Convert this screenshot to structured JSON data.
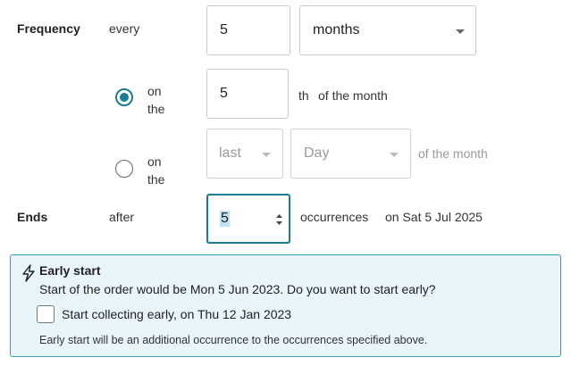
{
  "frequency": {
    "label": "Frequency",
    "every_label": "every",
    "interval_value": "5",
    "unit_selected": "months"
  },
  "on_the_day": {
    "selected": true,
    "label_line1": "on",
    "label_line2": "the",
    "day_value": "5",
    "suffix_th": "th",
    "suffix_text": "of the month"
  },
  "on_the_weekday": {
    "selected": false,
    "label_line1": "on",
    "label_line2": "the",
    "ordinal_selected": "last",
    "weekday_selected": "Day",
    "suffix_text": "of the month"
  },
  "ends": {
    "label": "Ends",
    "after_label": "after",
    "occurrences_value": "5",
    "occurrences_label": "occurrences",
    "end_date_text": "on Sat 5 Jul 2025"
  },
  "early_start": {
    "title": "Early start",
    "message": "Start of the order would be Mon 5 Jun 2023. Do you want to start early?",
    "checkbox_checked": false,
    "checkbox_label": "Start collecting early, on Thu 12 Jan 2023",
    "note": "Early start will be an additional occurrence to the occurrences specified above."
  },
  "colors": {
    "accent": "#1b7d93",
    "info_bg": "#e8f6fb",
    "info_border": "#3a9cb5"
  }
}
